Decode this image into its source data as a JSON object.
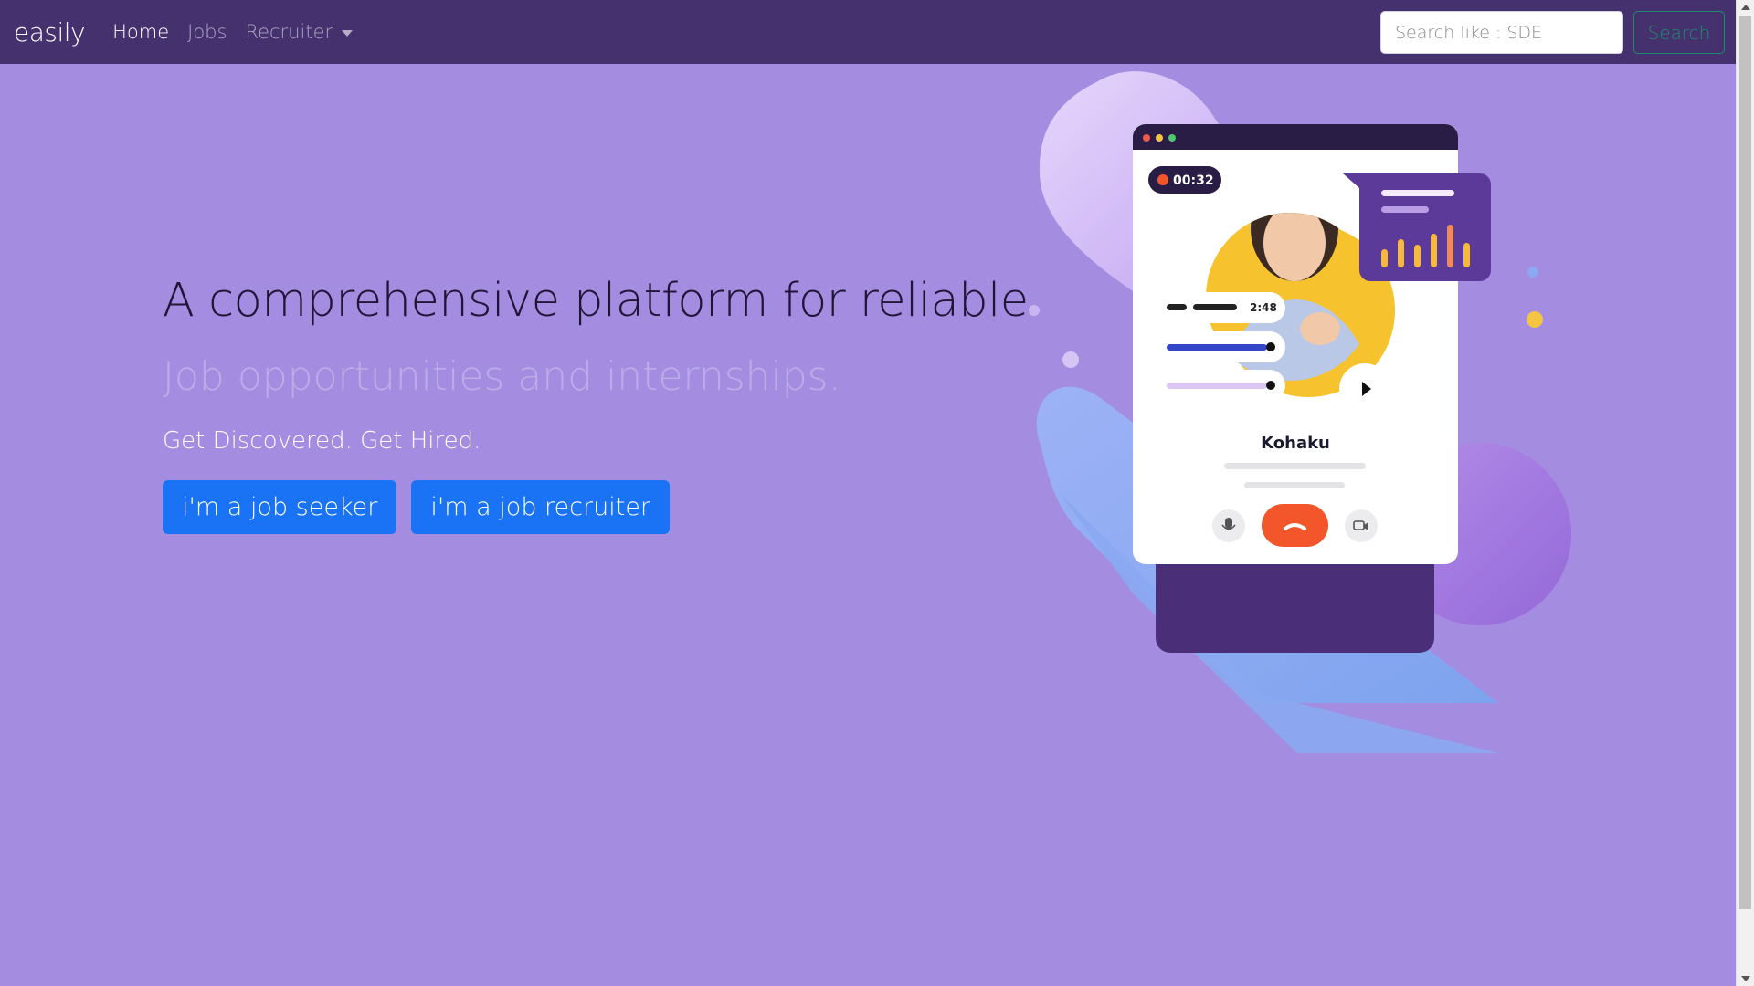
{
  "navbar": {
    "brand": "easily",
    "links": [
      {
        "label": "Home",
        "active": true
      },
      {
        "label": "Jobs",
        "active": false
      }
    ],
    "dropdown_label": "Recruiter",
    "search": {
      "placeholder": "Search like : SDE",
      "button_label": "Search"
    }
  },
  "hero": {
    "headline": "A comprehensive platform for reliable",
    "typed_text": "Job opportunities and internships.",
    "tagline": "Get Discovered. Get Hired.",
    "buttons": {
      "seeker": "i'm a job seeker",
      "recruiter": "i'm a job recruiter"
    }
  },
  "illustration": {
    "timer": "00:32",
    "track_time": "2:48",
    "caller_name": "Kohaku"
  },
  "colors": {
    "navbar_bg": "#46316f",
    "page_bg": "#a48ce0",
    "button_primary": "#1a73f5",
    "hangup": "#f2562a"
  }
}
